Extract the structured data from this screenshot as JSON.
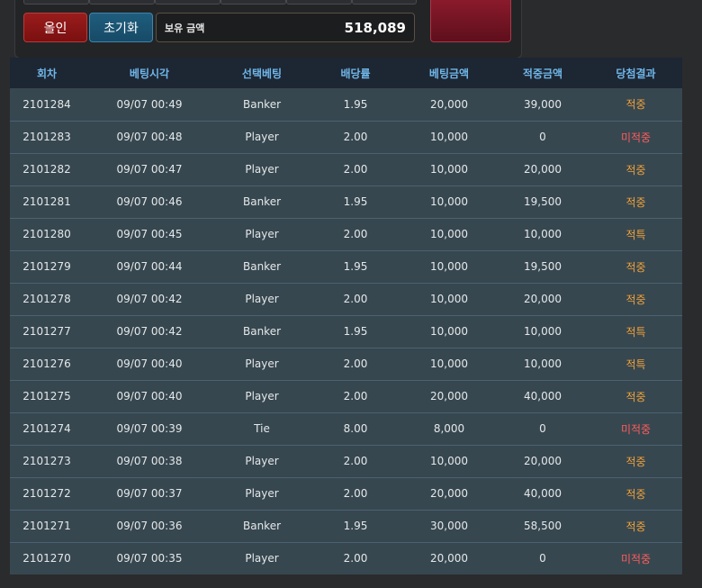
{
  "controls": {
    "allin_label": "올인",
    "reset_label": "초기화",
    "balance_label": "보유 금액",
    "balance_value": "518,089"
  },
  "colors": {
    "header_text": "#6fb6e8",
    "win": "#f2a23a",
    "lose": "#ff5d5d",
    "row_bg": "#37474f",
    "header_bg": "#1d2633"
  },
  "table": {
    "headers": [
      "회차",
      "베팅시각",
      "선택베팅",
      "배당률",
      "베팅금액",
      "적중금액",
      "당첨결과"
    ],
    "rows": [
      [
        "2101284",
        "09/07 00:49",
        "Banker",
        "1.95",
        "20,000",
        "39,000",
        "적중"
      ],
      [
        "2101283",
        "09/07 00:48",
        "Player",
        "2.00",
        "10,000",
        "0",
        "미적중"
      ],
      [
        "2101282",
        "09/07 00:47",
        "Player",
        "2.00",
        "10,000",
        "20,000",
        "적중"
      ],
      [
        "2101281",
        "09/07 00:46",
        "Banker",
        "1.95",
        "10,000",
        "19,500",
        "적중"
      ],
      [
        "2101280",
        "09/07 00:45",
        "Player",
        "2.00",
        "10,000",
        "10,000",
        "적특"
      ],
      [
        "2101279",
        "09/07 00:44",
        "Banker",
        "1.95",
        "10,000",
        "19,500",
        "적중"
      ],
      [
        "2101278",
        "09/07 00:42",
        "Player",
        "2.00",
        "10,000",
        "20,000",
        "적중"
      ],
      [
        "2101277",
        "09/07 00:42",
        "Banker",
        "1.95",
        "10,000",
        "10,000",
        "적특"
      ],
      [
        "2101276",
        "09/07 00:40",
        "Player",
        "2.00",
        "10,000",
        "10,000",
        "적특"
      ],
      [
        "2101275",
        "09/07 00:40",
        "Player",
        "2.00",
        "20,000",
        "40,000",
        "적중"
      ],
      [
        "2101274",
        "09/07 00:39",
        "Tie",
        "8.00",
        "8,000",
        "0",
        "미적중"
      ],
      [
        "2101273",
        "09/07 00:38",
        "Player",
        "2.00",
        "10,000",
        "20,000",
        "적중"
      ],
      [
        "2101272",
        "09/07 00:37",
        "Player",
        "2.00",
        "20,000",
        "40,000",
        "적중"
      ],
      [
        "2101271",
        "09/07 00:36",
        "Banker",
        "1.95",
        "30,000",
        "58,500",
        "적중"
      ],
      [
        "2101270",
        "09/07 00:35",
        "Player",
        "2.00",
        "20,000",
        "0",
        "미적중"
      ]
    ]
  }
}
